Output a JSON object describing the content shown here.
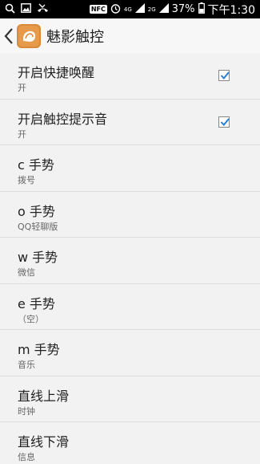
{
  "status_bar": {
    "nfc": "NFC",
    "net1": "4G",
    "net2": "2G",
    "battery": "37%",
    "time": "下午1:30"
  },
  "action_bar": {
    "title": "魅影触控"
  },
  "settings": [
    {
      "title": "开启快捷唤醒",
      "subtitle": "开",
      "checked": true
    },
    {
      "title": "开启触控提示音",
      "subtitle": "开",
      "checked": true
    },
    {
      "title": "c 手势",
      "subtitle": "拨号"
    },
    {
      "title": "o 手势",
      "subtitle": "QQ轻聊版"
    },
    {
      "title": "w 手势",
      "subtitle": "微信"
    },
    {
      "title": "e 手势",
      "subtitle": "（空）"
    },
    {
      "title": "m 手势",
      "subtitle": "音乐"
    },
    {
      "title": "直线上滑",
      "subtitle": "时钟"
    },
    {
      "title": "直线下滑",
      "subtitle": "信息"
    }
  ]
}
